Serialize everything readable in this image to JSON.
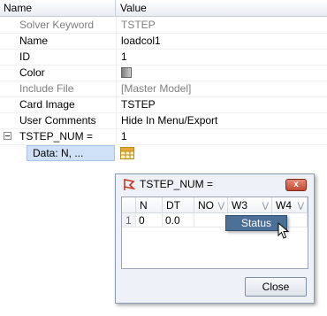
{
  "header": {
    "name_col": "Name",
    "value_col": "Value"
  },
  "properties": [
    {
      "name": "Solver Keyword",
      "value": "TSTEP"
    },
    {
      "name": "Name",
      "value": "loadcol1"
    },
    {
      "name": "ID",
      "value": "1"
    },
    {
      "name": "Color",
      "value": ""
    },
    {
      "name": "Include File",
      "value": "[Master Model]"
    },
    {
      "name": "Card Image",
      "value": "TSTEP"
    },
    {
      "name": "User Comments",
      "value": "Hide In Menu/Export"
    },
    {
      "name": "TSTEP_NUM =",
      "value": "1"
    }
  ],
  "data_cell": {
    "label": "Data: N, ..."
  },
  "dialog": {
    "title": "TSTEP_NUM =",
    "close_x": "x",
    "columns": [
      "N",
      "DT",
      "NO",
      "W3",
      "W4"
    ],
    "rows": [
      {
        "index": "1",
        "cells": [
          "0",
          "0.0",
          "",
          "",
          ""
        ]
      }
    ],
    "popup_label": "Status",
    "close_button": "Close"
  }
}
